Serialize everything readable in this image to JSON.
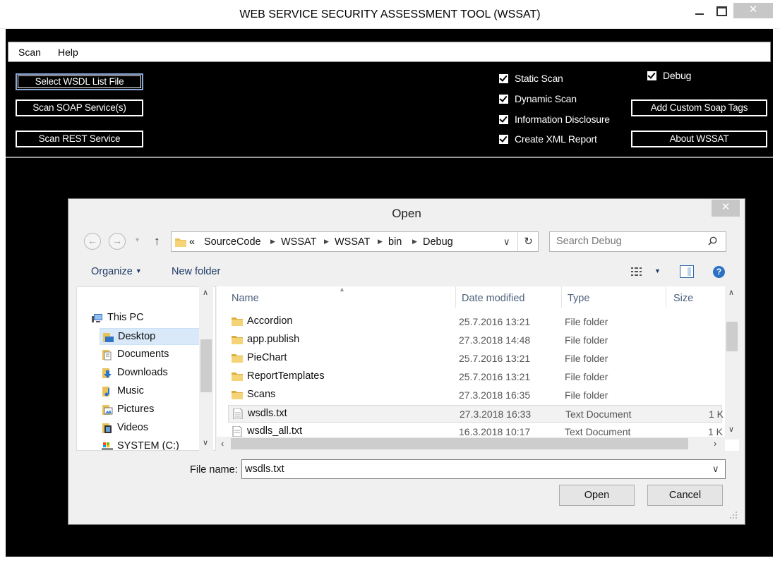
{
  "window": {
    "title": "WEB SERVICE SECURITY ASSESSMENT TOOL (WSSAT)",
    "minimize_icon": "minimize-icon",
    "maximize_icon": "maximize-icon",
    "close_glyph": "✕"
  },
  "menu": {
    "items": [
      "Scan",
      "Help"
    ]
  },
  "main": {
    "buttons": {
      "select_wsdl": "Select WSDL List File",
      "scan_soap": "Scan SOAP Service(s)",
      "scan_rest": "Scan REST Service",
      "add_custom_soap": "Add Custom Soap Tags",
      "about": "About WSSAT"
    },
    "checkboxes": [
      {
        "label": "Static Scan",
        "checked": true
      },
      {
        "label": "Dynamic Scan",
        "checked": true
      },
      {
        "label": "Information Disclosure",
        "checked": true
      },
      {
        "label": "Create XML Report",
        "checked": true
      }
    ],
    "debug": {
      "label": "Debug",
      "checked": true
    }
  },
  "dialog": {
    "title": "Open",
    "close_glyph": "✕",
    "nav": {
      "back": "←",
      "forward": "→",
      "up": "↑",
      "dropdown": "▾"
    },
    "address": {
      "overflow": "«",
      "crumbs": [
        "SourceCode",
        "WSSAT",
        "WSSAT",
        "bin",
        "Debug"
      ],
      "dropdown_glyph": "∨",
      "refresh_glyph": "↻"
    },
    "search": {
      "placeholder": "Search Debug"
    },
    "toolbar": {
      "organize": "Organize",
      "new_folder": "New folder"
    },
    "nav_pane": {
      "items": [
        {
          "label": "This PC",
          "icon": "computer-icon"
        },
        {
          "label": "Desktop",
          "icon": "desktop-folder-icon",
          "selected": true
        },
        {
          "label": "Documents",
          "icon": "documents-folder-icon"
        },
        {
          "label": "Downloads",
          "icon": "downloads-folder-icon"
        },
        {
          "label": "Music",
          "icon": "music-folder-icon"
        },
        {
          "label": "Pictures",
          "icon": "pictures-folder-icon"
        },
        {
          "label": "Videos",
          "icon": "videos-folder-icon"
        },
        {
          "label": "SYSTEM (C:)",
          "icon": "drive-icon"
        }
      ]
    },
    "columns": {
      "name": "Name",
      "date": "Date modified",
      "type": "Type",
      "size": "Size"
    },
    "files": [
      {
        "name": "Accordion",
        "date": "25.7.2016 13:21",
        "type": "File folder",
        "size": "",
        "kind": "folder"
      },
      {
        "name": "app.publish",
        "date": "27.3.2018 14:48",
        "type": "File folder",
        "size": "",
        "kind": "folder"
      },
      {
        "name": "PieChart",
        "date": "25.7.2016 13:21",
        "type": "File folder",
        "size": "",
        "kind": "folder"
      },
      {
        "name": "ReportTemplates",
        "date": "25.7.2016 13:21",
        "type": "File folder",
        "size": "",
        "kind": "folder"
      },
      {
        "name": "Scans",
        "date": "27.3.2018 16:35",
        "type": "File folder",
        "size": "",
        "kind": "folder"
      },
      {
        "name": "wsdls.txt",
        "date": "27.3.2018 16:33",
        "type": "Text Document",
        "size": "1 K",
        "kind": "file",
        "selected": true
      },
      {
        "name": "wsdls_all.txt",
        "date": "16.3.2018 10:17",
        "type": "Text Document",
        "size": "1 K",
        "kind": "file"
      }
    ],
    "file_name": {
      "label": "File name:",
      "value": "wsdls.txt"
    },
    "buttons": {
      "open": "Open",
      "cancel": "Cancel"
    }
  },
  "colors": {
    "frame": "#000000",
    "selection": "#d9e9f9",
    "link": "#1e3a66"
  }
}
